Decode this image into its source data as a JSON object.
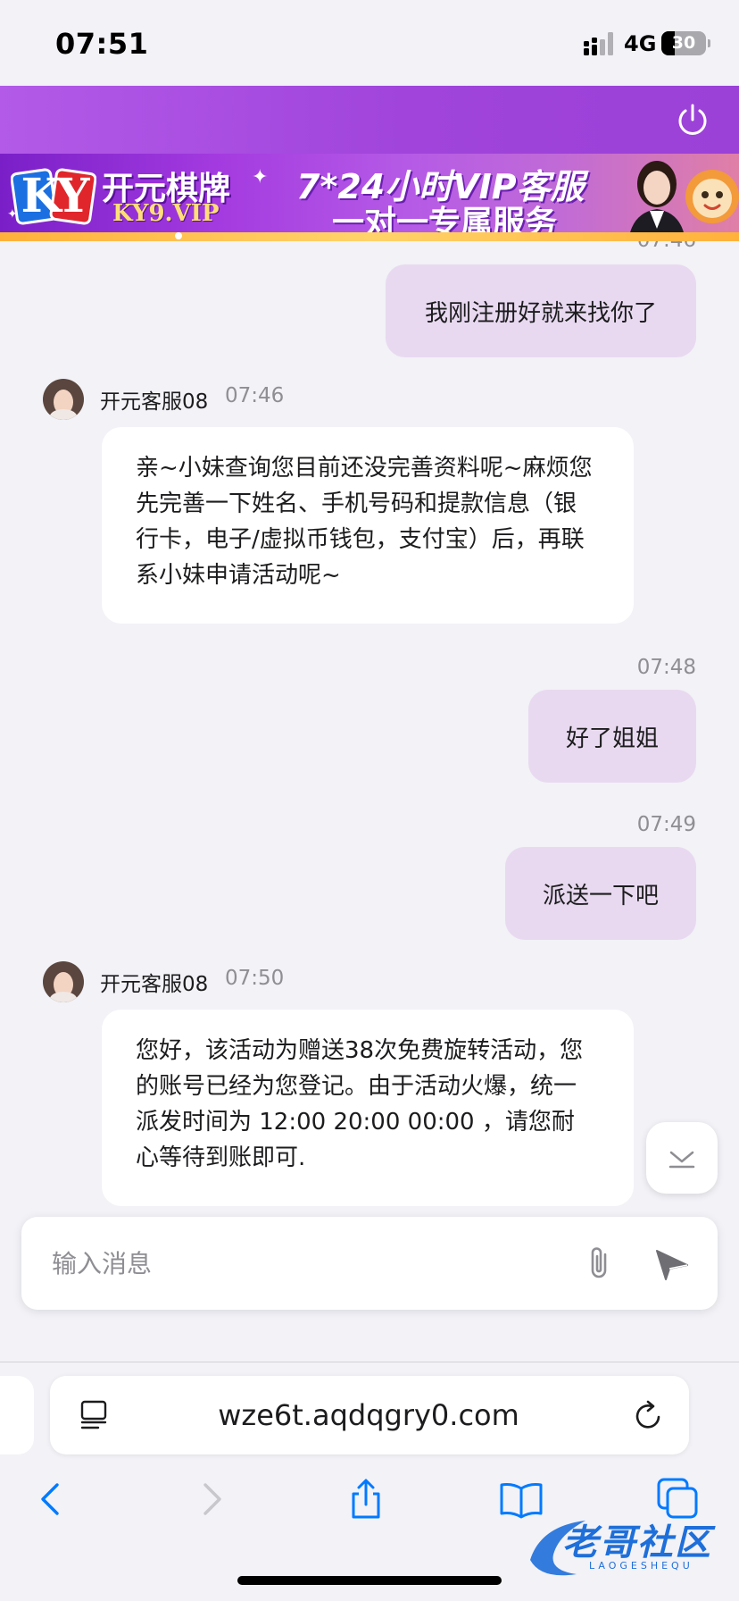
{
  "status_bar": {
    "time": "07:51",
    "network": "4G",
    "battery": "30",
    "battery_level": 0.3
  },
  "banner": {
    "logo_text": "KY",
    "brand_cn": "开元棋牌",
    "brand_en": "KY9.VIP",
    "headline": "7*24小时VIP客服",
    "subline": "一对一专属服务"
  },
  "chat": {
    "partial_time": "07:46",
    "messages": [
      {
        "type": "out",
        "text": "我刚注册好就来找你了"
      },
      {
        "type": "in",
        "name": "开元客服08",
        "time": "07:46",
        "lines": [
          "亲~小妹查询您目前还没完善资料呢~麻烦您",
          "先完善一下姓名、手机号码和提款信息（银",
          "行卡，电子/虚拟币钱包，支付宝）后，再联",
          "系小妹申请活动呢~"
        ]
      },
      {
        "type": "out",
        "time": "07:48",
        "text": "好了姐姐"
      },
      {
        "type": "out",
        "time": "07:49",
        "text": "派送一下吧"
      },
      {
        "type": "in",
        "name": "开元客服08",
        "time": "07:50",
        "lines": [
          "您好，该活动为赠送38次免费旋转活动，您",
          "的账号已经为您登记。由于活动火爆，统一",
          "派发时间为 12:00 20:00 00:00 ，请您耐",
          "心等待到账即可."
        ]
      }
    ]
  },
  "input": {
    "placeholder": "输入消息",
    "value": ""
  },
  "browser": {
    "url": "wze6t.aqdqgry0.com"
  },
  "watermark": {
    "text": "老哥社区",
    "sub": "LAOGESHEQU"
  },
  "colors": {
    "header": "#a044db",
    "bubble_out": "#e8d9f0",
    "bubble_in": "#ffffff",
    "ios_blue": "#007aff"
  }
}
